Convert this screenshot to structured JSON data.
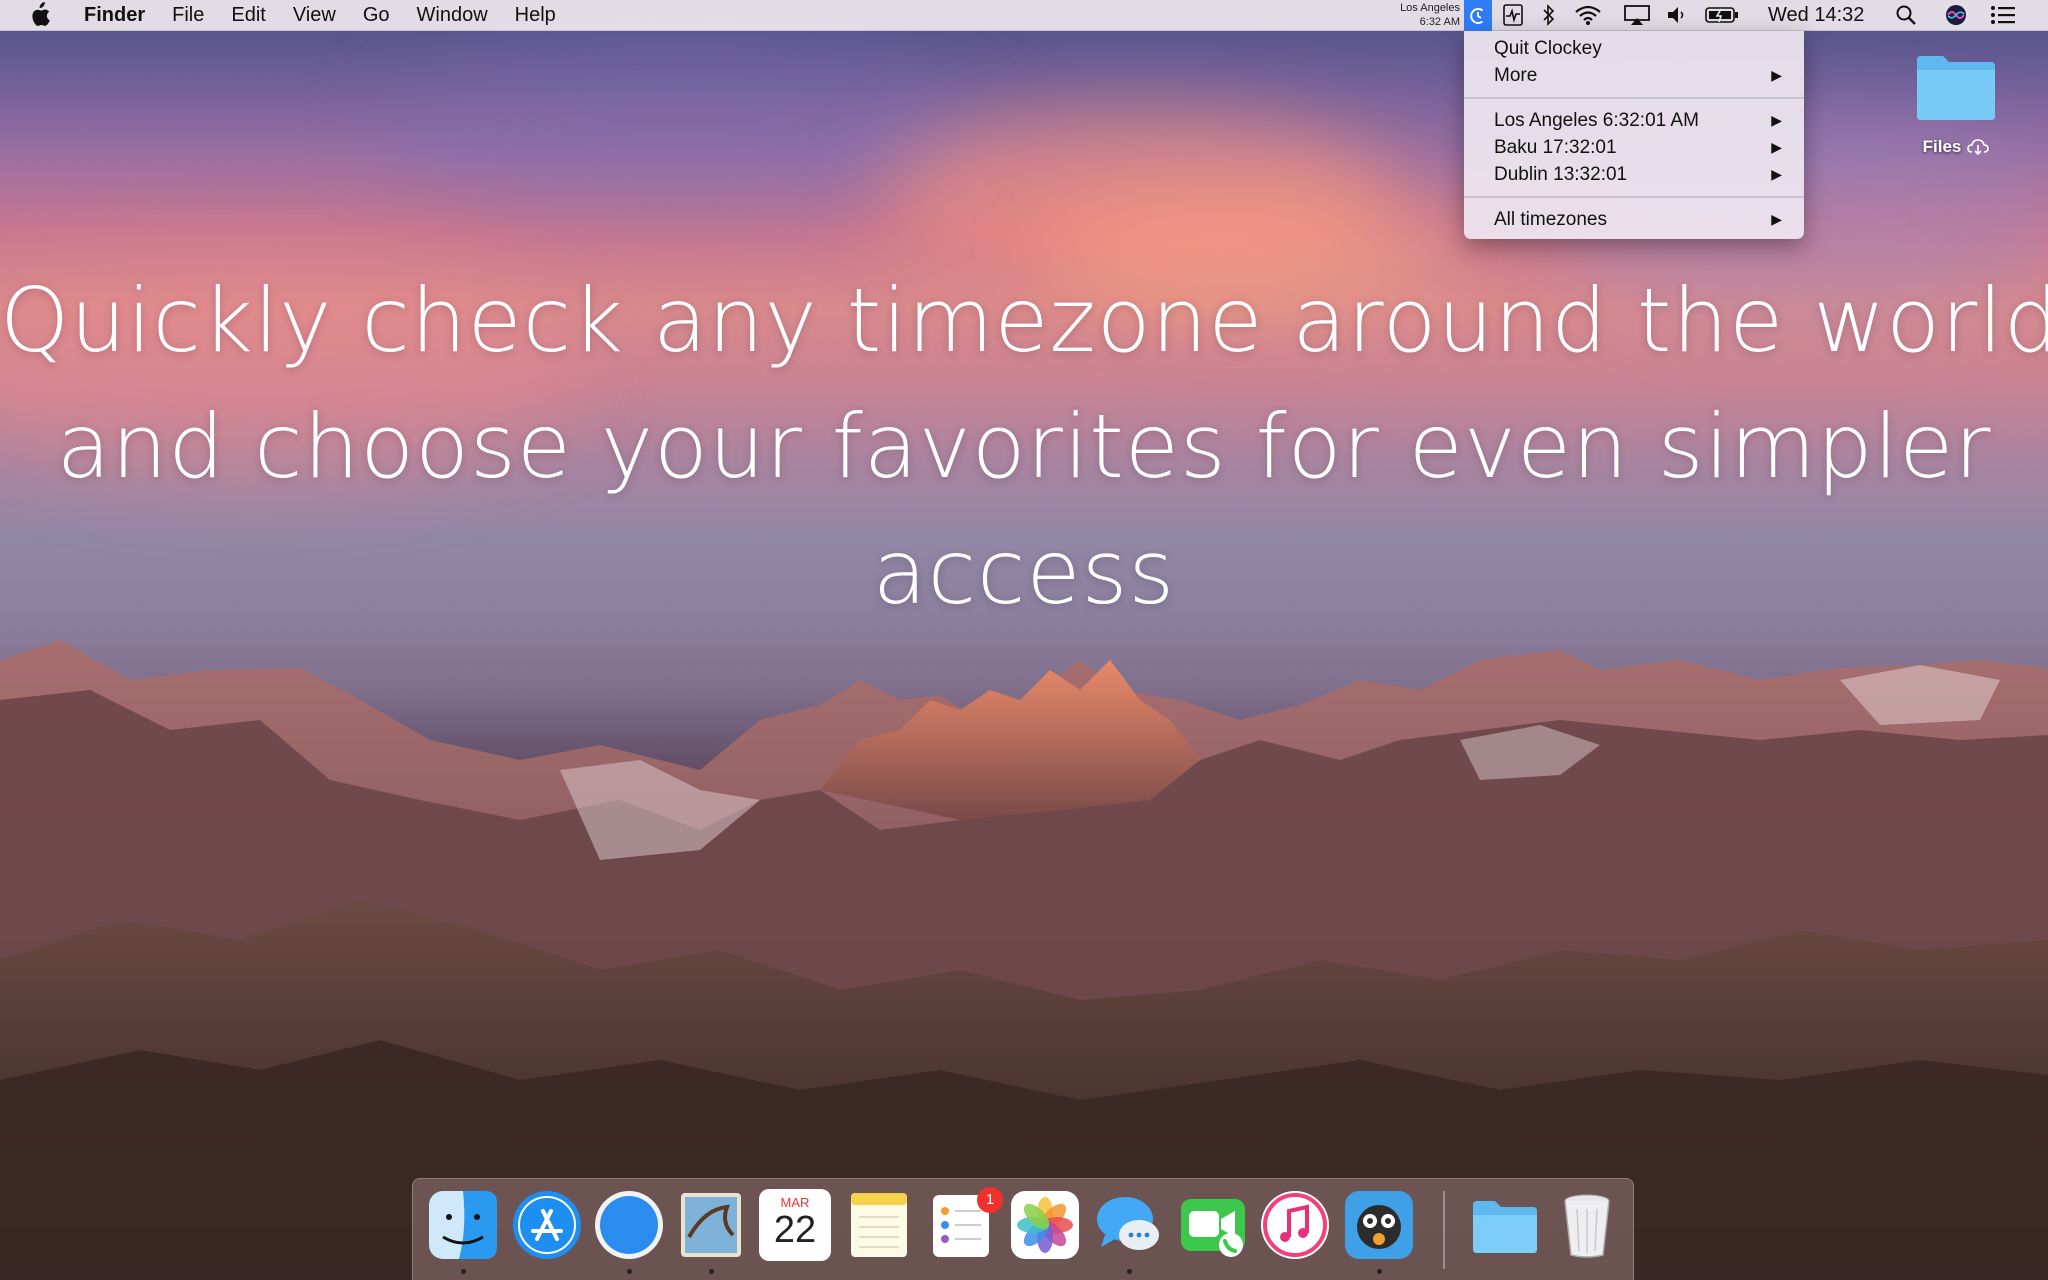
{
  "menubar": {
    "app_name": "Finder",
    "menus": [
      "File",
      "Edit",
      "View",
      "Go",
      "Window",
      "Help"
    ],
    "mini_clock": {
      "city": "Los Angeles",
      "time": "6:32 AM"
    },
    "datetime": "Wed 14:32"
  },
  "dropdown": {
    "items": [
      {
        "label": "Quit Clockey",
        "submenu": false
      },
      {
        "label": "More",
        "submenu": true
      }
    ],
    "timezones": [
      {
        "label": "Los Angeles 6:32:01 AM",
        "submenu": true
      },
      {
        "label": "Baku 17:32:01",
        "submenu": true
      },
      {
        "label": "Dublin 13:32:01",
        "submenu": true
      }
    ],
    "footer": {
      "label": "All timezones",
      "submenu": true
    },
    "arrow_glyph": "▶"
  },
  "desktop": {
    "folder_label": "Files"
  },
  "headline": {
    "line1": "Quickly check any timezone around the world",
    "line2": "and choose your favorites for even simpler",
    "line3": "access"
  },
  "dock": {
    "calendar_month": "MAR",
    "calendar_day": "22",
    "reminders_badge": "1"
  },
  "colors": {
    "clockey_accent": "#2f7df6",
    "badge_red": "#f0302a"
  }
}
